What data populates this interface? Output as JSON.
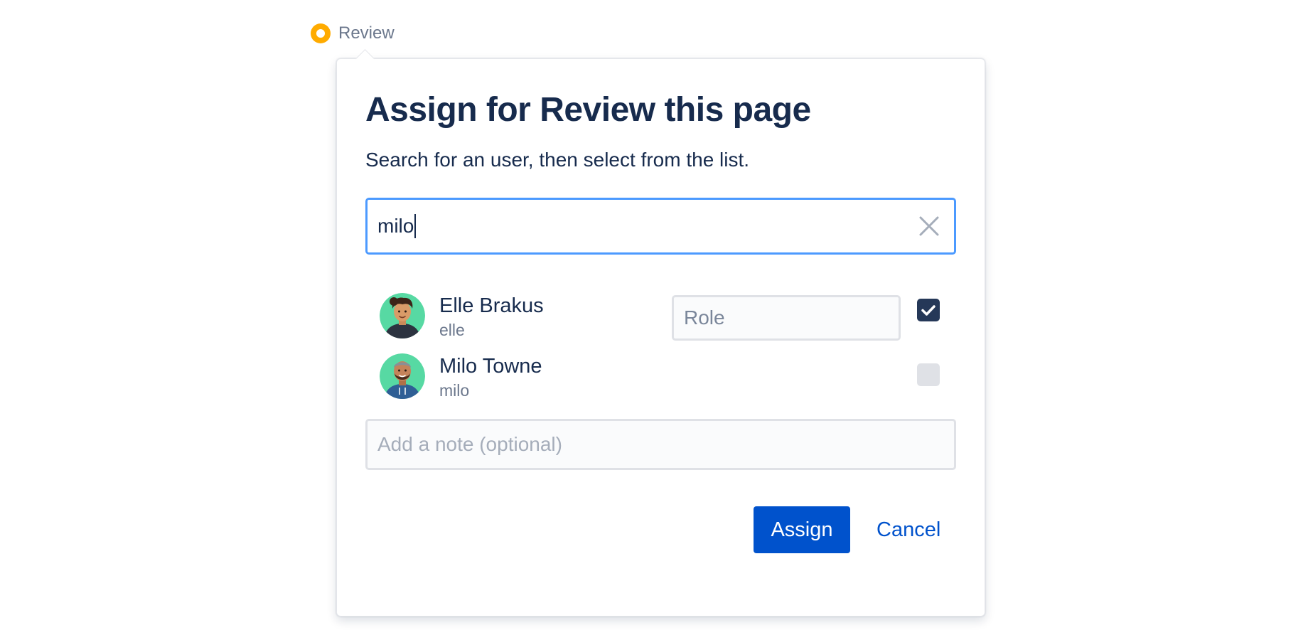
{
  "status": {
    "label": "Review",
    "color": "#ffab00"
  },
  "dialog": {
    "title": "Assign for Review this page",
    "subtitle": "Search for an user, then select from the list.",
    "search": {
      "value": "milo",
      "clear_icon": "close-icon"
    },
    "users": [
      {
        "name": "Elle Brakus",
        "handle": "elle",
        "role_placeholder": "Role",
        "checked": true,
        "avatar": "avatar-icon"
      },
      {
        "name": "Milo Towne",
        "handle": "milo",
        "checked": false,
        "avatar": "avatar-icon"
      }
    ],
    "note_placeholder": "Add a note (optional)",
    "assign_label": "Assign",
    "cancel_label": "Cancel"
  },
  "colors": {
    "primary": "#0052cc",
    "focus_border": "#4c9aff",
    "text": "#172b4d",
    "subtle_text": "#6b778c",
    "avatar_bg": "#57d9a3",
    "checkbox_checked": "#253858"
  }
}
